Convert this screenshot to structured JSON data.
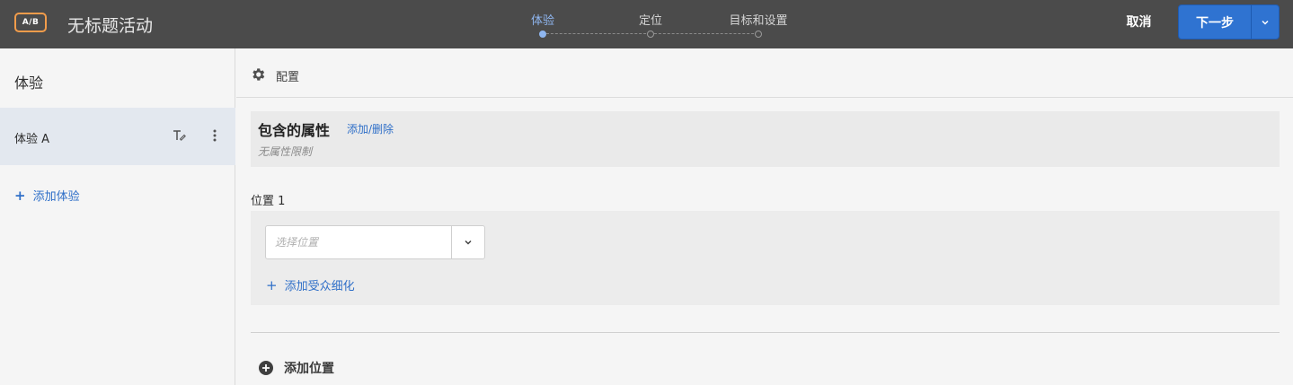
{
  "header": {
    "badge": "A/B",
    "title": "无标题活动",
    "steps": [
      {
        "label": "体验",
        "active": true
      },
      {
        "label": "定位",
        "active": false
      },
      {
        "label": "目标和设置",
        "active": false
      }
    ],
    "cancel_label": "取消",
    "next_label": "下一步"
  },
  "sidebar": {
    "title": "体验",
    "experiences": [
      {
        "label": "体验 A",
        "selected": true
      }
    ],
    "add_label": "添加体验"
  },
  "main": {
    "config_label": "配置",
    "attributes": {
      "title": "包含的属性",
      "link": "添加/删除",
      "empty_text": "无属性限制"
    },
    "location": {
      "title": "位置 1",
      "select_placeholder": "选择位置",
      "add_refinement_label": "添加受众细化"
    },
    "add_location_label": "添加位置"
  },
  "colors": {
    "topbar": "#4b4b4b",
    "accent": "#2f73d1",
    "badge_border": "#f29c4b",
    "active_step": "#8fb6f0",
    "link": "#2f6fc8"
  }
}
